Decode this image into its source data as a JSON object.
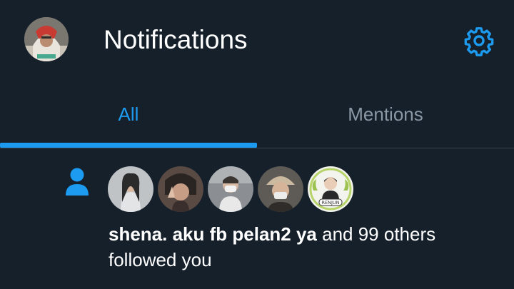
{
  "header": {
    "title": "Notifications",
    "settings_icon": "gear-icon",
    "accent": "#1d9bf0"
  },
  "tabs": [
    {
      "label": "All",
      "selected": true
    },
    {
      "label": "Mentions",
      "selected": false
    }
  ],
  "notification": {
    "type_icon": "person-icon",
    "avatars": [
      "avatar-1",
      "avatar-2",
      "avatar-3",
      "avatar-4",
      "avatar-5"
    ],
    "avatar5_badge": "RENJUN",
    "bold_name": "shena. aku fb pelan2 ya",
    "rest_line1": " and 99 others",
    "line2": "followed you"
  },
  "colors": {
    "background": "#15202b",
    "divider": "#38444d",
    "muted_text": "#8b98a5"
  }
}
